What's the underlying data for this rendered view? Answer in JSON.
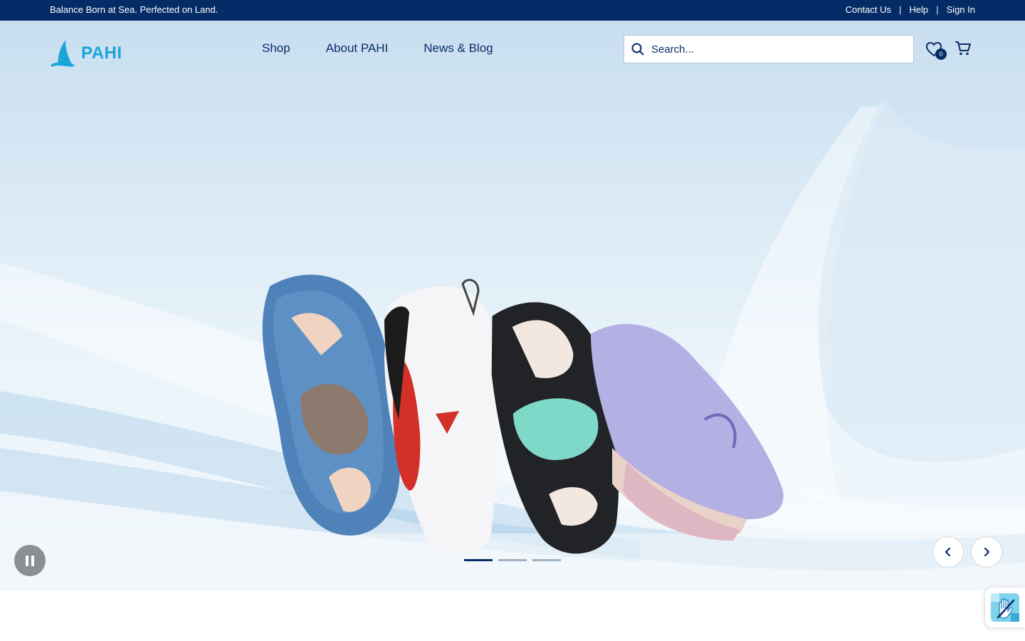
{
  "topbar": {
    "tagline": "Balance Born at Sea. Perfected on Land.",
    "links": [
      "Contact Us",
      "Help",
      "Sign In"
    ],
    "separator": "|"
  },
  "header": {
    "logo_text": "PAHI",
    "nav": [
      "Shop",
      "About PAHI",
      "News & Blog"
    ],
    "search_placeholder": "Search...",
    "wishlist_count": "0"
  },
  "hero": {
    "slides_total": 3,
    "active_slide": 1
  },
  "icons": {
    "search": "search-icon",
    "wishlist": "heart-icon",
    "cart": "cart-icon",
    "pause": "pause-icon",
    "prev": "chevron-left-icon",
    "next": "chevron-right-icon",
    "accessibility": "accessibility-hand-icon"
  },
  "colors": {
    "topbar_bg": "#052c67",
    "nav_text": "#0b2d6b",
    "brand_blue": "#1aa6d8",
    "shoe_blue": "#4f82b8",
    "shoe_red": "#d3302a",
    "shoe_mint": "#7fd9c9",
    "shoe_lilac": "#b4b0e4"
  }
}
